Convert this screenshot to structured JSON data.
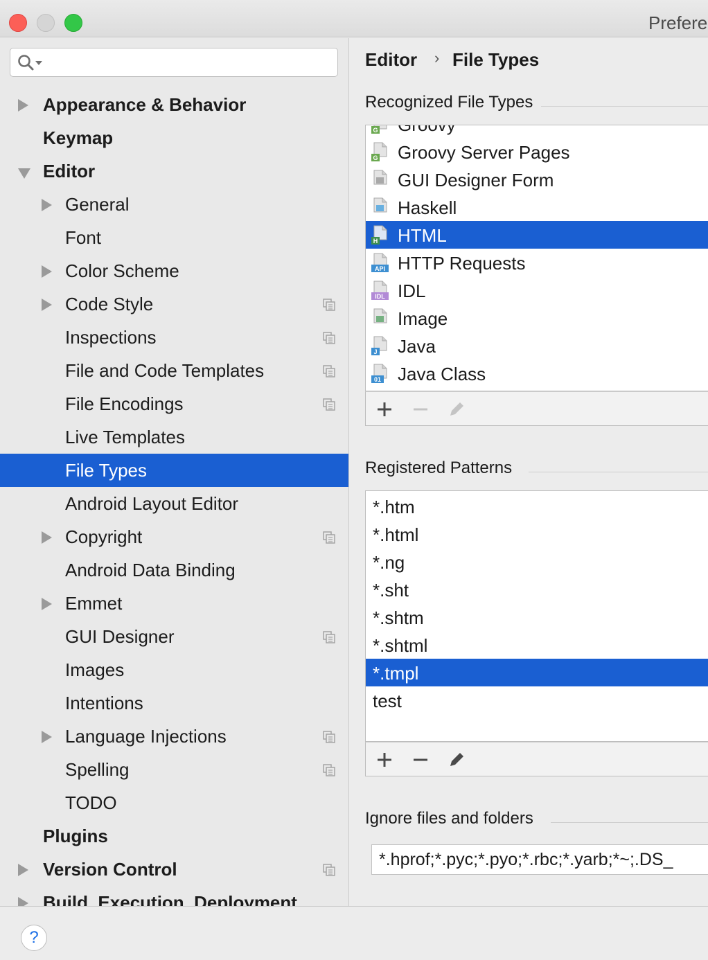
{
  "window": {
    "title": "Prefere"
  },
  "search": {
    "placeholder": ""
  },
  "sidebar": {
    "items": [
      {
        "label": "Appearance & Behavior",
        "level": 0,
        "bold": true,
        "expander": "right",
        "project": false,
        "selected": false
      },
      {
        "label": "Keymap",
        "level": 0,
        "bold": true,
        "expander": "none",
        "project": false,
        "selected": false
      },
      {
        "label": "Editor",
        "level": 0,
        "bold": true,
        "expander": "down",
        "project": false,
        "selected": false
      },
      {
        "label": "General",
        "level": 1,
        "bold": false,
        "expander": "right",
        "project": false,
        "selected": false
      },
      {
        "label": "Font",
        "level": 1,
        "bold": false,
        "expander": "none",
        "project": false,
        "selected": false
      },
      {
        "label": "Color Scheme",
        "level": 1,
        "bold": false,
        "expander": "right",
        "project": false,
        "selected": false
      },
      {
        "label": "Code Style",
        "level": 1,
        "bold": false,
        "expander": "right",
        "project": true,
        "selected": false
      },
      {
        "label": "Inspections",
        "level": 1,
        "bold": false,
        "expander": "none",
        "project": true,
        "selected": false
      },
      {
        "label": "File and Code Templates",
        "level": 1,
        "bold": false,
        "expander": "none",
        "project": true,
        "selected": false
      },
      {
        "label": "File Encodings",
        "level": 1,
        "bold": false,
        "expander": "none",
        "project": true,
        "selected": false
      },
      {
        "label": "Live Templates",
        "level": 1,
        "bold": false,
        "expander": "none",
        "project": false,
        "selected": false
      },
      {
        "label": "File Types",
        "level": 1,
        "bold": false,
        "expander": "none",
        "project": false,
        "selected": true
      },
      {
        "label": "Android Layout Editor",
        "level": 1,
        "bold": false,
        "expander": "none",
        "project": false,
        "selected": false
      },
      {
        "label": "Copyright",
        "level": 1,
        "bold": false,
        "expander": "right",
        "project": true,
        "selected": false
      },
      {
        "label": "Android Data Binding",
        "level": 1,
        "bold": false,
        "expander": "none",
        "project": false,
        "selected": false
      },
      {
        "label": "Emmet",
        "level": 1,
        "bold": false,
        "expander": "right",
        "project": false,
        "selected": false
      },
      {
        "label": "GUI Designer",
        "level": 1,
        "bold": false,
        "expander": "none",
        "project": true,
        "selected": false
      },
      {
        "label": "Images",
        "level": 1,
        "bold": false,
        "expander": "none",
        "project": false,
        "selected": false
      },
      {
        "label": "Intentions",
        "level": 1,
        "bold": false,
        "expander": "none",
        "project": false,
        "selected": false
      },
      {
        "label": "Language Injections",
        "level": 1,
        "bold": false,
        "expander": "right",
        "project": true,
        "selected": false
      },
      {
        "label": "Spelling",
        "level": 1,
        "bold": false,
        "expander": "none",
        "project": true,
        "selected": false
      },
      {
        "label": "TODO",
        "level": 1,
        "bold": false,
        "expander": "none",
        "project": false,
        "selected": false
      },
      {
        "label": "Plugins",
        "level": 0,
        "bold": true,
        "expander": "none",
        "project": false,
        "selected": false
      },
      {
        "label": "Version Control",
        "level": 0,
        "bold": true,
        "expander": "right",
        "project": true,
        "selected": false
      },
      {
        "label": "Build, Execution, Deployment",
        "level": 0,
        "bold": true,
        "expander": "right",
        "project": false,
        "selected": false
      }
    ]
  },
  "main": {
    "breadcrumb": {
      "first": "Editor",
      "separator": "›",
      "second": "File Types"
    },
    "recognized": {
      "title": "Recognized File Types",
      "items": [
        {
          "label": "Groovy",
          "icon": "groovy-file-icon",
          "badge": "G",
          "badge_color": "#6aa84f",
          "selected": false
        },
        {
          "label": "Groovy Server Pages",
          "icon": "gsp-file-icon",
          "badge": "G",
          "badge_color": "#6aa84f",
          "selected": false
        },
        {
          "label": "GUI Designer Form",
          "icon": "form-file-icon",
          "badge": "",
          "badge_color": "#9a9a9a",
          "selected": false
        },
        {
          "label": "Haskell",
          "icon": "haskell-file-icon",
          "badge": "",
          "badge_color": "#4aa3df",
          "selected": false
        },
        {
          "label": "HTML",
          "icon": "html-file-icon",
          "badge": "H",
          "badge_color": "#3f8f4f",
          "selected": true
        },
        {
          "label": "HTTP Requests",
          "icon": "api-file-icon",
          "badge": "API",
          "badge_color": "#3d8fd1",
          "selected": false
        },
        {
          "label": "IDL",
          "icon": "idl-file-icon",
          "badge": "IDL",
          "badge_color": "#b28ad6",
          "selected": false
        },
        {
          "label": "Image",
          "icon": "image-file-icon",
          "badge": "",
          "badge_color": "#5aa469",
          "selected": false
        },
        {
          "label": "Java",
          "icon": "java-file-icon",
          "badge": "J",
          "badge_color": "#3d8fd1",
          "selected": false
        },
        {
          "label": "Java Class",
          "icon": "class-file-icon",
          "badge": "01",
          "badge_color": "#3d8fd1",
          "selected": false
        }
      ]
    },
    "patterns": {
      "title": "Registered Patterns",
      "items": [
        {
          "label": "*.htm",
          "selected": false
        },
        {
          "label": "*.html",
          "selected": false
        },
        {
          "label": "*.ng",
          "selected": false
        },
        {
          "label": "*.sht",
          "selected": false
        },
        {
          "label": "*.shtm",
          "selected": false
        },
        {
          "label": "*.shtml",
          "selected": false
        },
        {
          "label": "*.tmpl",
          "selected": true
        },
        {
          "label": "test",
          "selected": false
        }
      ]
    },
    "ignore": {
      "title": "Ignore files and folders",
      "value": "*.hprof;*.pyc;*.pyo;*.rbc;*.yarb;*~;.DS_"
    }
  },
  "colors": {
    "selection": "#1a5fd2",
    "accent_help": "#1a6ee6"
  },
  "help": {
    "label": "?"
  }
}
